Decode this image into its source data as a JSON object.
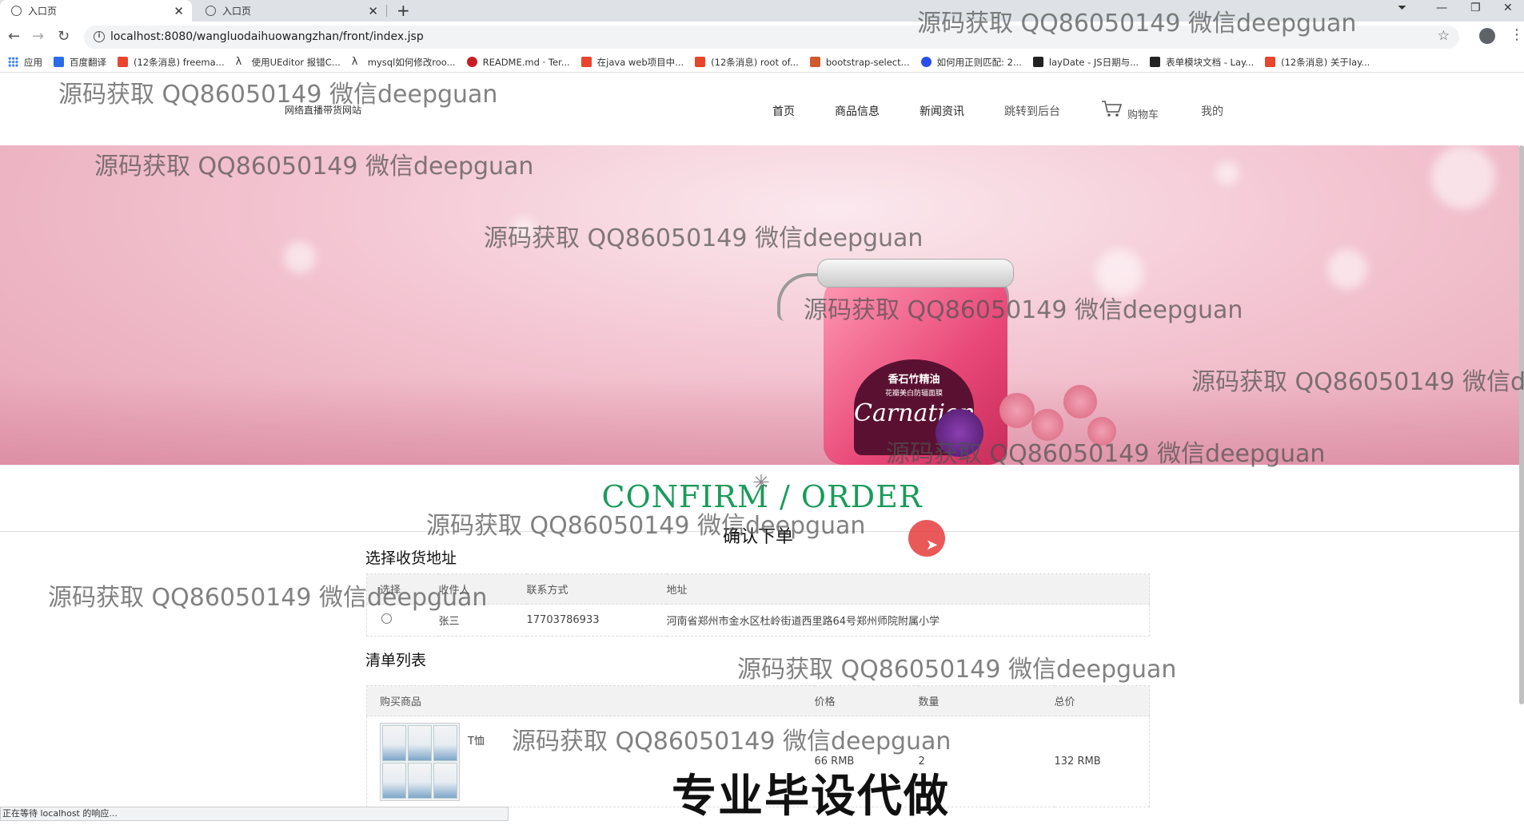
{
  "browser": {
    "tabs": [
      {
        "title": "入口页"
      },
      {
        "title": "入口页"
      }
    ],
    "url": "localhost:8080/wangluodaihuowangzhan/front/index.jsp",
    "bookmarks": [
      {
        "label": "应用",
        "icon": "apps-icon"
      },
      {
        "label": "百度翻译",
        "icon": "baidu-translate-icon",
        "color": "#2b6de8"
      },
      {
        "label": "(12条消息) freema...",
        "icon": "csdn-icon",
        "color": "#e8452c"
      },
      {
        "label": "使用UEditor 报错C...",
        "icon": "lambda-icon",
        "color": "#333333"
      },
      {
        "label": "mysql如何修改roo...",
        "icon": "lambda-icon",
        "color": "#333333"
      },
      {
        "label": "README.md · Ter...",
        "icon": "gitee-icon",
        "color": "#c71d23"
      },
      {
        "label": "在java web项目中...",
        "icon": "csdn-icon",
        "color": "#e8452c"
      },
      {
        "label": "(12条消息) root of...",
        "icon": "csdn-icon",
        "color": "#e8452c"
      },
      {
        "label": "bootstrap-select...",
        "icon": "grid-icon",
        "color": "#d05a2c"
      },
      {
        "label": "如何用正则匹配: 2...",
        "icon": "baidu-icon",
        "color": "#2b4ee8"
      },
      {
        "label": "layDate - JS日期与...",
        "icon": "layui-icon",
        "color": "#222222"
      },
      {
        "label": "表单模块文档 - Lay...",
        "icon": "layui-icon",
        "color": "#222222"
      },
      {
        "label": "(12条消息) 关于lay...",
        "icon": "csdn-icon",
        "color": "#e8452c"
      }
    ],
    "status": "正在等待 localhost 的响应..."
  },
  "site": {
    "name": "网络直播带货网站",
    "nav": [
      "首页",
      "商品信息",
      "新闻资讯",
      "跳转到后台",
      "购物车",
      "我的"
    ]
  },
  "banner": {
    "product_cn": "香石竹精油",
    "product_cn_sub": "花瓣美白防辐面膜",
    "product_brand": "Carnation"
  },
  "order": {
    "title_en": "CONFIRM / ORDER",
    "title_cn": "确认下单",
    "address_section_title": "选择收货地址",
    "address_headers": [
      "选择",
      "收件人",
      "联系方式",
      "地址"
    ],
    "addresses": [
      {
        "name": "张三",
        "phone": "17703786933",
        "address": "河南省郑州市金水区杜岭街道西里路64号郑州师院附属小学"
      }
    ],
    "list_section_title": "清单列表",
    "item_headers": [
      "购买商品",
      "价格",
      "数量",
      "总价"
    ],
    "items": [
      {
        "name": "T恤",
        "price": "66 RMB",
        "quantity": "2",
        "total": "132 RMB"
      }
    ]
  },
  "overlays": {
    "watermark": "源码获取 QQ86050149 微信deepguan",
    "ad": "专业毕设代做"
  },
  "colors": {
    "accent_green": "#1a9b5a",
    "cursor_red": "#e63c3c"
  }
}
